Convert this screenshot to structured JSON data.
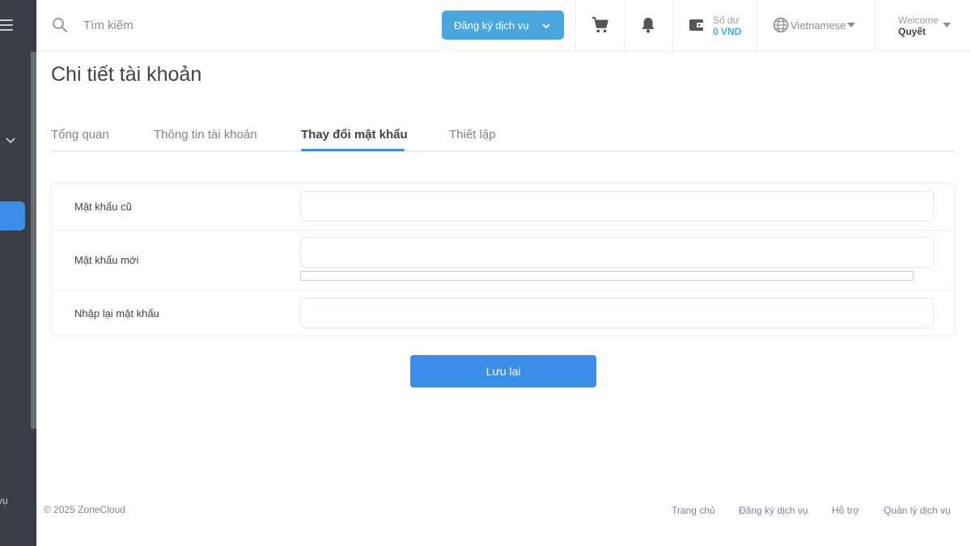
{
  "sidebar": {
    "cut_label": "vụ"
  },
  "header": {
    "search": {
      "placeholder": "Tìm kiếm"
    },
    "register_button": "Đăng ký dịch vụ",
    "balance": {
      "label": "Số dư",
      "value": "0 VND"
    },
    "language": "Vietnamese",
    "user": {
      "welcome": "Welcome",
      "name": "Quyết"
    }
  },
  "page": {
    "title": "Chi tiết tài khoản",
    "tabs": [
      {
        "label": "Tổng quan",
        "active": false
      },
      {
        "label": "Thông tin tài khoản",
        "active": false
      },
      {
        "label": "Thay đổi mật khẩu",
        "active": true
      },
      {
        "label": "Thiết lập",
        "active": false
      }
    ],
    "form": {
      "old_password_label": "Mật khẩu cũ",
      "new_password_label": "Mật khẩu mới",
      "confirm_password_label": "Nhập lại mật khẩu"
    },
    "save_button": "Lưu lại"
  },
  "footer": {
    "copyright": "© 2025 ZoneCloud",
    "links": [
      "Trang chủ",
      "Đăng ký dịch vụ",
      "Hỗ trợ",
      "Quản lý dịch vụ"
    ]
  },
  "colors": {
    "sidebar_bg": "#3a3d45",
    "accent": "#3c8de8",
    "register_button": "#4aa7de"
  }
}
